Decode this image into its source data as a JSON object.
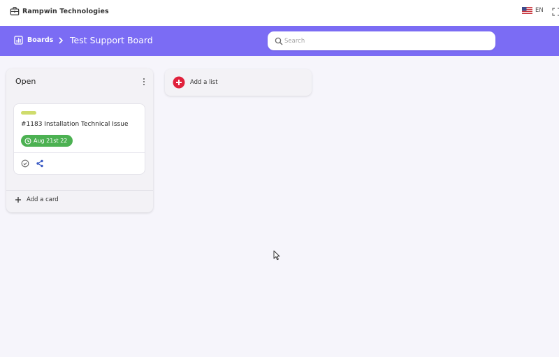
{
  "header": {
    "company_name": "Rampwin Technologies",
    "language_code": "EN"
  },
  "toolbar": {
    "boards_label": "Boards",
    "board_title": "Test Support Board",
    "search_placeholder": "Search",
    "search_value": "",
    "accent_color": "#7b6cf4"
  },
  "lists": [
    {
      "title": "Open",
      "cards": [
        {
          "label_color": "#cfdc6c",
          "title": "#1183 Installation Technical Issue",
          "due_date": "Aug 21st 22",
          "due_color": "#4cb152"
        }
      ],
      "add_card_label": "Add a card"
    }
  ],
  "add_list": {
    "label": "Add a list",
    "icon_color": "#e0213c"
  }
}
